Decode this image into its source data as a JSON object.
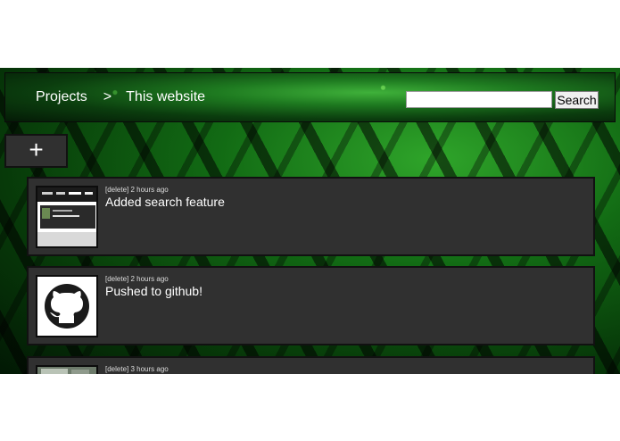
{
  "breadcrumb": {
    "projects": "Projects",
    "separator": ">",
    "current": "This website"
  },
  "search": {
    "value": "",
    "placeholder": "",
    "button_label": "Search"
  },
  "add_button": {
    "label": "+"
  },
  "entries": [
    {
      "action": "[delete]",
      "time": "2 hours ago",
      "title": "Added search feature",
      "thumbnail": "screenshot"
    },
    {
      "action": "[delete]",
      "time": "2 hours ago",
      "title": "Pushed to github!",
      "thumbnail": "github-icon"
    },
    {
      "action": "[delete]",
      "time": "3 hours ago",
      "title": "",
      "thumbnail": "photo"
    }
  ],
  "colors": {
    "card_bg": "#303030",
    "accent_green": "#1e7a20"
  }
}
